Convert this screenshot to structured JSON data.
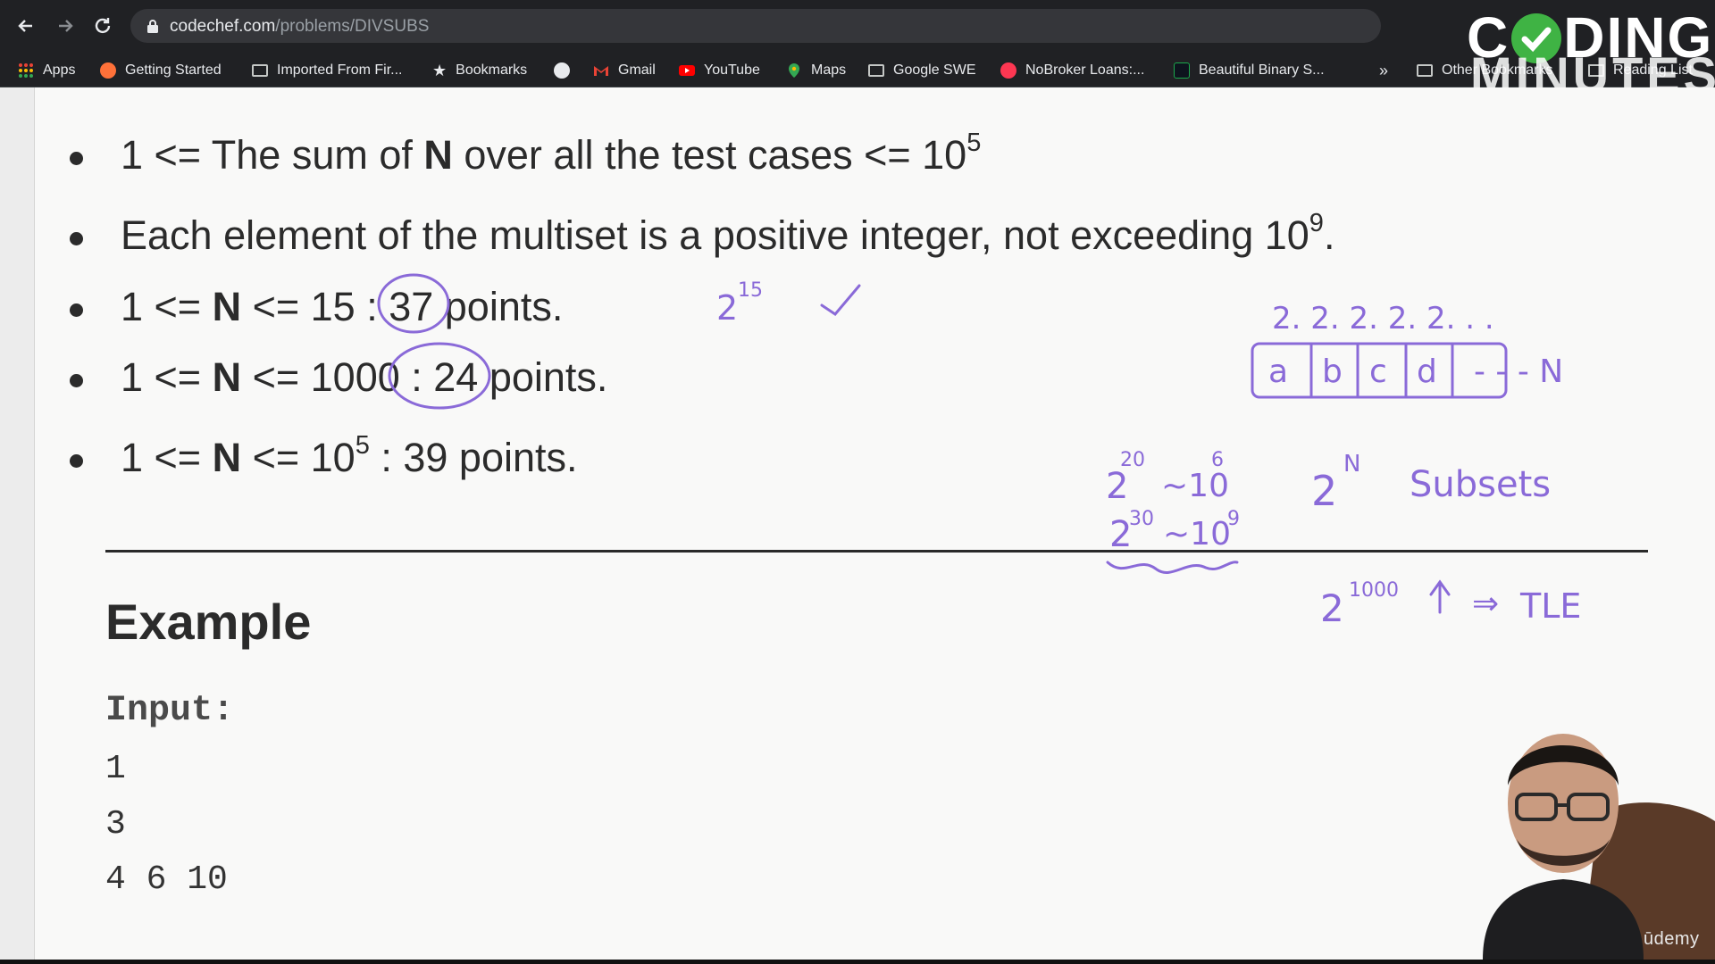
{
  "browser": {
    "url_domain": "codechef.com",
    "url_path": "/problems/DIVSUBS",
    "bookmarks": [
      {
        "label": "Apps",
        "icon": "apps-grid-icon",
        "color": "#ea4335"
      },
      {
        "label": "Getting Started",
        "icon": "firefox-icon",
        "color": "#ff7139"
      },
      {
        "label": "Imported From Fir...",
        "icon": "folder-icon",
        "color": "#c4c7c5"
      },
      {
        "label": "Bookmarks",
        "icon": "star-icon",
        "color": "#e8eaed"
      },
      {
        "label": "",
        "icon": "github-icon",
        "color": "#e8eaed"
      },
      {
        "label": "Gmail",
        "icon": "gmail-icon",
        "color": "#ea4335"
      },
      {
        "label": "YouTube",
        "icon": "youtube-icon",
        "color": "#ff0000"
      },
      {
        "label": "Maps",
        "icon": "maps-icon",
        "color": "#34a853"
      },
      {
        "label": "Google SWE",
        "icon": "folder-icon",
        "color": "#c4c7c5"
      },
      {
        "label": "NoBroker Loans:...",
        "icon": "nobroker-icon",
        "color": "#fd3752"
      },
      {
        "label": "Beautiful Binary S...",
        "icon": "hackerrank-icon",
        "color": "#1ba94c"
      }
    ],
    "overflow_label": "»",
    "other_bookmarks": "Other Bookmarks",
    "reading_list": "Reading List"
  },
  "logo": {
    "word_left": "C",
    "word_right": "DING",
    "sub": "MINUTES",
    "check_color": "#3fb344"
  },
  "constraints": [
    {
      "pre": "1 <= The sum of ",
      "bold": "N",
      "post": " over all the test cases <= 10",
      "sup": "5",
      "tail": ""
    },
    {
      "pre": "Each element of the multiset is a positive integer, not exceeding 10",
      "bold": "",
      "post": "",
      "sup": "9",
      "tail": "."
    },
    {
      "pre": "1 <= ",
      "bold": "N",
      "post": " <= 15 : 37 points.",
      "sup": "",
      "tail": ""
    },
    {
      "pre": "1 <= ",
      "bold": "N",
      "post": " <= 1000 : 24 points.",
      "sup": "",
      "tail": ""
    },
    {
      "pre": "1 <= ",
      "bold": "N",
      "post": " <= 10",
      "sup": "5",
      "tail": " : 39 points."
    }
  ],
  "example": {
    "title": "Example",
    "input_label": "Input:",
    "input_lines": [
      "1",
      "3",
      "4  6  10"
    ]
  },
  "annotations": {
    "ink_color": "#8a6ad8",
    "power_15": {
      "base": "2",
      "exp": "15"
    },
    "array_top": "2. 2. 2. 2. 2. . .",
    "array_cells": [
      "a",
      "b",
      "c",
      "d"
    ],
    "array_tail": "- - - N",
    "approx_1": {
      "base": "2",
      "exp": "20",
      "approx": "~10",
      "approx_exp": "6"
    },
    "approx_2": {
      "base": "2",
      "exp": "30",
      "approx": "~10",
      "approx_exp": "9"
    },
    "subsets": {
      "base": "2",
      "exp": "N",
      "label": "Subsets"
    },
    "tle": {
      "base": "2",
      "exp": "1000",
      "arrow": "↑",
      "implies": "⇒",
      "label": "TLE"
    }
  },
  "watermark": "ūdemy"
}
